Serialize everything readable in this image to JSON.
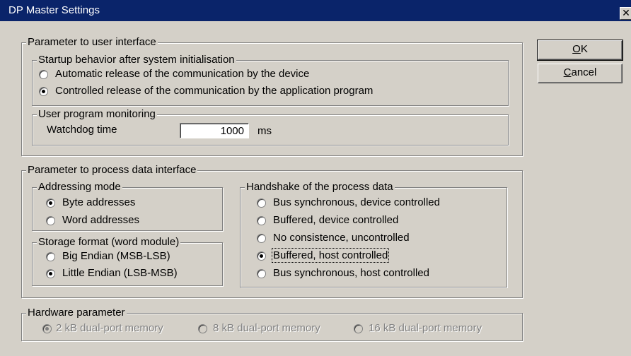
{
  "window": {
    "title": "DP Master Settings",
    "close_glyph": "✕"
  },
  "buttons": {
    "ok": {
      "mnemonic": "O",
      "rest": "K"
    },
    "cancel": {
      "mnemonic": "C",
      "rest": "ancel"
    }
  },
  "user_interface": {
    "legend": "Parameter to user interface",
    "startup": {
      "legend": "Startup behavior after system initialisation",
      "options": [
        {
          "label": "Automatic release of the communication by the device",
          "checked": false
        },
        {
          "label": "Controlled release of the communication by the application program",
          "checked": true
        }
      ]
    },
    "monitoring": {
      "legend": "User program monitoring",
      "watchdog_label": "Watchdog time",
      "watchdog_value": "1000",
      "watchdog_unit": "ms"
    }
  },
  "process_data": {
    "legend": "Parameter to process data interface",
    "addressing": {
      "legend": "Addressing mode",
      "options": [
        {
          "label": "Byte addresses",
          "checked": true
        },
        {
          "label": "Word addresses",
          "checked": false
        }
      ]
    },
    "storage": {
      "legend": "Storage format (word module)",
      "options": [
        {
          "label": "Big Endian (MSB-LSB)",
          "checked": false
        },
        {
          "label": "Little Endian (LSB-MSB)",
          "checked": true
        }
      ]
    },
    "handshake": {
      "legend": "Handshake of the process data",
      "options": [
        {
          "label": "Bus synchronous, device controlled",
          "checked": false
        },
        {
          "label": "Buffered, device controlled",
          "checked": false
        },
        {
          "label": "No consistence, uncontrolled",
          "checked": false
        },
        {
          "label": "Buffered, host controlled",
          "checked": true
        },
        {
          "label": "Bus synchronous, host controlled",
          "checked": false
        }
      ]
    }
  },
  "hardware": {
    "legend": "Hardware parameter",
    "options": [
      {
        "label": "2 kB dual-port memory",
        "checked": true,
        "disabled": true
      },
      {
        "label": "8 kB dual-port memory",
        "checked": false,
        "disabled": true
      },
      {
        "label": "16 kB dual-port memory",
        "checked": false,
        "disabled": true
      }
    ]
  }
}
